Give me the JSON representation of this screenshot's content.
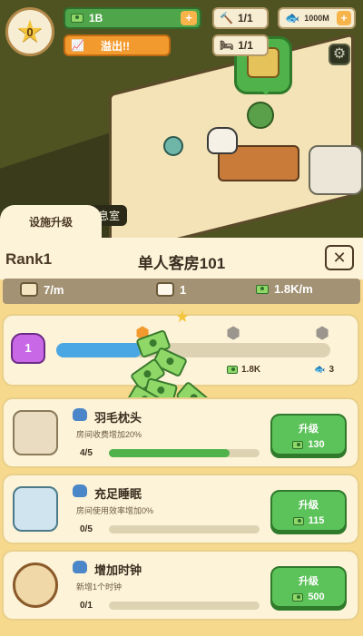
{
  "hud": {
    "level": "0",
    "cash": "1B",
    "overflow_label": "溢出!!",
    "hammer": "1/1",
    "fish": "1000M",
    "bed": "1/1"
  },
  "scene": {
    "rest_room_label": "二休息室"
  },
  "panel": {
    "tab_label": "设施升级",
    "rank": "Rank1",
    "room_name": "单人客房101",
    "close_symbol": "✕",
    "stats": {
      "per_minute": "7/m",
      "cats": "1",
      "income": "1.8K/m"
    },
    "progress": {
      "cat_level": "1",
      "fill_fraction": 0.31,
      "reward_money": "1.8K",
      "reward_fish": "3"
    },
    "upgrades": [
      {
        "name": "羽毛枕头",
        "desc": "房间收费增加20%",
        "count": "4/5",
        "fill_fraction": 0.8,
        "button_label": "升级",
        "cost": "130"
      },
      {
        "name": "充足睡眠",
        "desc": "房间使用效率增加0%",
        "count": "0/5",
        "fill_fraction": 0,
        "button_label": "升级",
        "cost": "115"
      },
      {
        "name": "增加时钟",
        "desc": "新增1个时钟",
        "count": "0/1",
        "fill_fraction": 0,
        "button_label": "升级",
        "cost": "500"
      }
    ]
  },
  "colors": {
    "money_green": "#4fa64a",
    "overflow_orange": "#f29a2e",
    "panel_bg": "#f7d98d",
    "card_bg": "#fdf3d8",
    "progress_blue": "#4aa7e4",
    "button_green": "#5cc25a"
  }
}
